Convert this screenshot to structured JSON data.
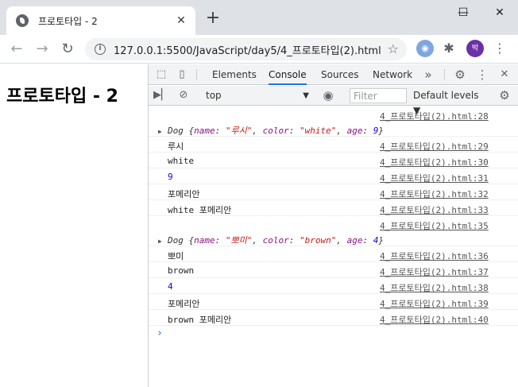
{
  "tab": {
    "title": "프로토타입 - 2",
    "close": "✕",
    "new_tab": "+"
  },
  "window": {
    "minimize": "—",
    "maximize": "☐",
    "close": "✕"
  },
  "nav": {
    "back": "←",
    "forward": "→",
    "reload": "↻",
    "url": "127.0.0.1:5500/JavaScript/day5/4_프로토타입(2).html",
    "star": "☆",
    "info": "i"
  },
  "extensions": {
    "avatar_label": "박",
    "menu": "⋮",
    "puzzle": "✱",
    "ring": "◉"
  },
  "page": {
    "heading": "프로토타입 - 2"
  },
  "devtools": {
    "tabs": [
      "Elements",
      "Console",
      "Sources",
      "Network"
    ],
    "more": "»",
    "gear": "⚙",
    "kebab": "⋮",
    "close": "✕",
    "context": "top",
    "filter_placeholder": "Filter",
    "levels": "Default levels ▼",
    "prompt": "›"
  },
  "console_rows": [
    {
      "type": "obj",
      "prefix": "Dog {",
      "k1": "name",
      "v1": "\"루시\"",
      "k2": "color",
      "v2": "\"white\"",
      "k3": "age",
      "v3": "9",
      "suffix": "}",
      "src": "4_프로토타입(2).html:28"
    },
    {
      "type": "text",
      "msg": "루시",
      "src": "4_프로토타입(2).html:29"
    },
    {
      "type": "text",
      "msg": "white",
      "src": "4_프로토타입(2).html:30"
    },
    {
      "type": "num",
      "msg": "9",
      "src": "4_프로토타입(2).html:31"
    },
    {
      "type": "text",
      "msg": "포메리안",
      "src": "4_프로토타입(2).html:32"
    },
    {
      "type": "text",
      "msg": "white 포메리안",
      "src": "4_프로토타입(2).html:33"
    },
    {
      "type": "obj",
      "prefix": "Dog {",
      "k1": "name",
      "v1": "\"뽀미\"",
      "k2": "color",
      "v2": "\"brown\"",
      "k3": "age",
      "v3": "4",
      "suffix": "}",
      "src": "4_프로토타입(2).html:35"
    },
    {
      "type": "text",
      "msg": "뽀미",
      "src": "4_프로토타입(2).html:36"
    },
    {
      "type": "text",
      "msg": "brown",
      "src": "4_프로토타입(2).html:37"
    },
    {
      "type": "num",
      "msg": "4",
      "src": "4_프로토타입(2).html:38"
    },
    {
      "type": "text",
      "msg": "포메리안",
      "src": "4_프로토타입(2).html:39"
    },
    {
      "type": "text",
      "msg": "brown 포메리안",
      "src": "4_프로토타입(2).html:40"
    }
  ]
}
